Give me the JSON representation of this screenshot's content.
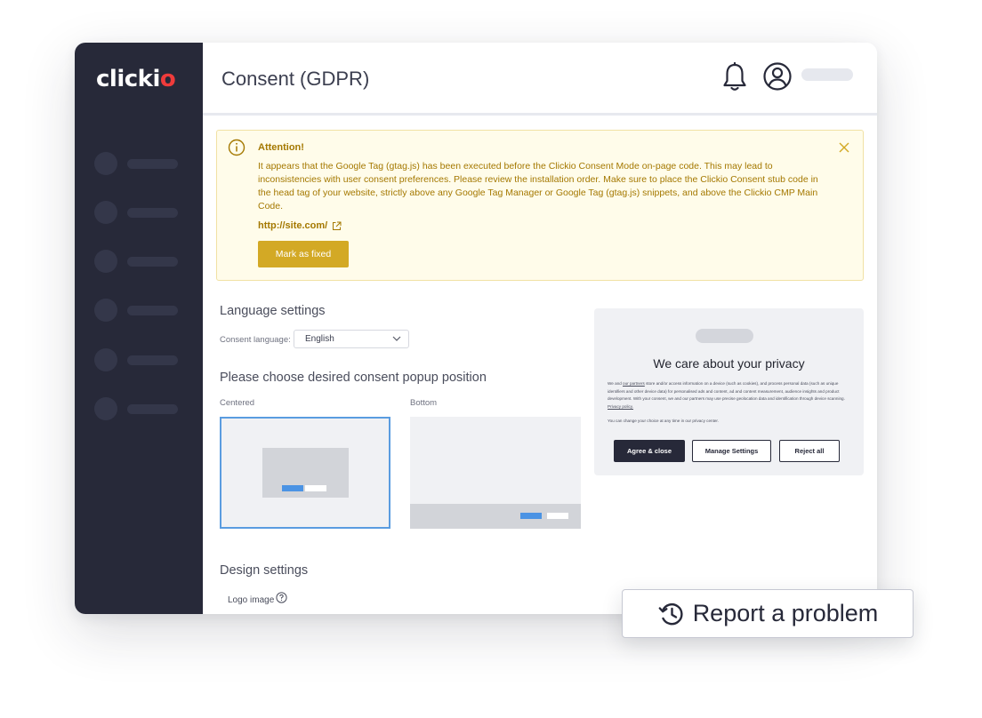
{
  "logo": {
    "text_main": "click",
    "text_i": "i",
    "text_o": "o"
  },
  "header": {
    "title": "Consent (GDPR)"
  },
  "alert": {
    "title": "Attention!",
    "message": "It appears that the Google Tag (gtag.js) has been executed before the Clickio Consent Mode on-page code. This may lead to inconsistencies with user consent preferences. Please review the installation order. Make sure to place the Clickio Consent stub code in the head tag of your website, strictly above any Google Tag Manager or Google Tag (gtag.js) snippets, and above the Clickio CMP Main Code.",
    "link": "http://site.com/",
    "button": "Mark as fixed"
  },
  "language": {
    "title": "Language settings",
    "label": "Consent language:",
    "selected": "English"
  },
  "position": {
    "title": "Please choose desired consent popup position",
    "options": [
      {
        "label": "Centered",
        "selected": true
      },
      {
        "label": "Bottom",
        "selected": false
      }
    ]
  },
  "preview": {
    "title": "We care about your privacy",
    "text_before_link": "We and ",
    "partners_link": "our partners",
    "text_after_link": " store and/or access information on a device (such as cookies), and process personal data (such as unique identifiers and other device data) for personalised ads and content, ad and content measurement, audience insights and product development. With your consent, we and our partners may use precise geolocation data and identification through device scanning. ",
    "privacy_link": "Privacy policy.",
    "text2": "You can change your choice at any time in our privacy center.",
    "agree_button": "Agree & close",
    "manage_button": "Manage Settings",
    "reject_button": "Reject all"
  },
  "design": {
    "title": "Design settings",
    "logo_label": "Logo image"
  },
  "report": {
    "label": "Report a problem"
  },
  "colors": {
    "sidebar": "#272939",
    "accent_logo": "#ef3b3b",
    "alert_text": "#a47800",
    "alert_bg": "#fffcea",
    "button_gold": "#d3a925",
    "selection_blue": "#5a9ce0"
  }
}
